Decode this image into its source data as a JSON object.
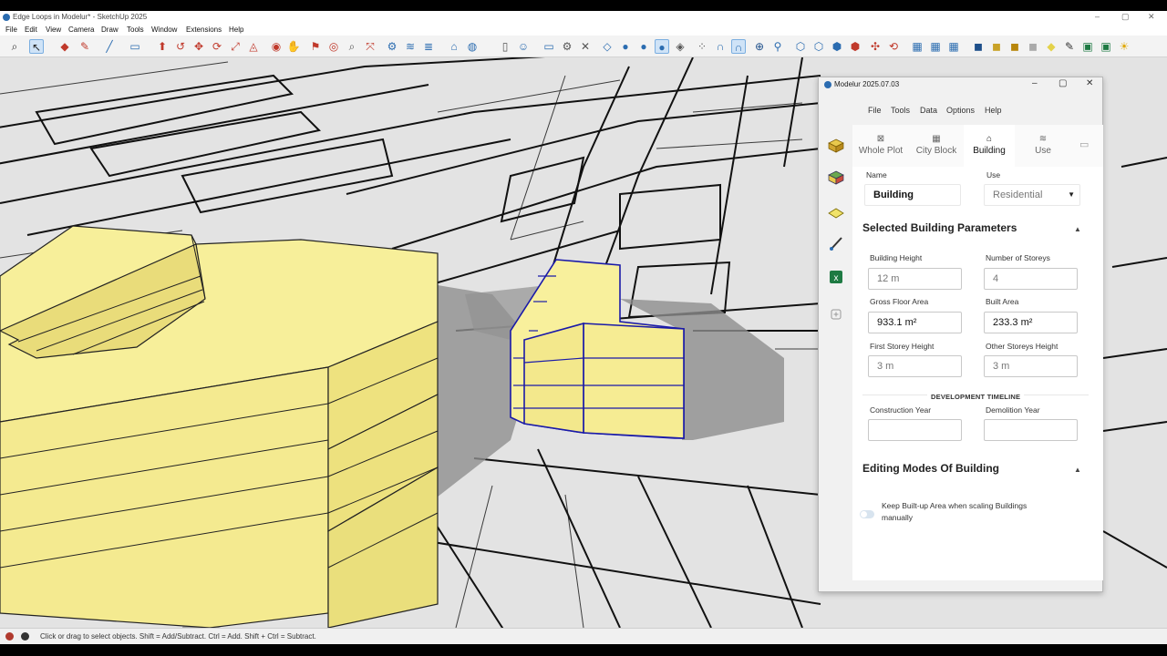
{
  "window": {
    "title": "Edge Loops in Modelur* - SketchUp 2025"
  },
  "menubar": {
    "items": [
      "File",
      "Edit",
      "View",
      "Camera",
      "Draw",
      "Tools",
      "Window",
      "Extensions",
      "Help"
    ]
  },
  "toolbar": {
    "icons": [
      "zoom-icon",
      "select-icon",
      "eraser-icon",
      "pencil-icon",
      "line-icon",
      "rectangle-icon",
      "push-pull-icon",
      "move-icon",
      "rotate-icon",
      "scale-icon",
      "offset-icon",
      "orbit-icon",
      "pan-icon",
      "section-plane-icon",
      "modelur-tool-icon",
      "components-icon",
      "materials-icon",
      "sandbox-icon",
      "water-drop-icon",
      "magnet-icon",
      "plus-circle-icon",
      "box-icon",
      "layers-icon",
      "excel-icon",
      "sun-icon"
    ]
  },
  "statusbar": {
    "message": "Click or drag to select objects. Shift = Add/Subtract. Ctrl = Add. Shift + Ctrl = Subtract."
  },
  "panel": {
    "title": "Modelur 2025.07.03",
    "menu": [
      "File",
      "Tools",
      "Data",
      "Options",
      "Help"
    ],
    "tabs": [
      {
        "label": "Whole Plot",
        "icon": "plot-icon"
      },
      {
        "label": "City Block",
        "icon": "grid-icon"
      },
      {
        "label": "Building",
        "icon": "house-icon"
      },
      {
        "label": "Use",
        "icon": "layers-icon"
      }
    ],
    "active_tab": "Building",
    "name_label": "Name",
    "name_value": "Building",
    "use_label": "Use",
    "use_value": "Residential",
    "params_title": "Selected Building Parameters",
    "fields": {
      "building_height": {
        "label": "Building Height",
        "value": "12 m"
      },
      "number_of_storeys": {
        "label": "Number of Storeys",
        "value": "4"
      },
      "gross_floor_area": {
        "label": "Gross Floor Area",
        "value": "933.1 m²"
      },
      "built_area": {
        "label": "Built Area",
        "value": "233.3 m²"
      },
      "first_storey_height": {
        "label": "First Storey Height",
        "value": "3 m"
      },
      "other_storeys_height": {
        "label": "Other Storeys Height",
        "value": "3 m"
      }
    },
    "timeline_title": "DEVELOPMENT TIMELINE",
    "construction_year": {
      "label": "Construction Year",
      "value": ""
    },
    "demolition_year": {
      "label": "Demolition Year",
      "value": ""
    },
    "editing_title": "Editing Modes Of Building",
    "keep_area_line1": "Keep Built-up Area when scaling Buildings",
    "keep_area_line2": "manually",
    "keep_area_toggle": false
  }
}
